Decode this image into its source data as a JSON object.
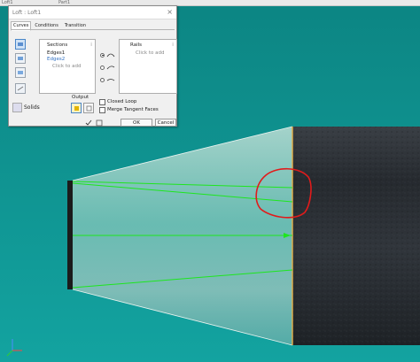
{
  "top": {
    "left_text": "Loft1",
    "mid_text": "Part1"
  },
  "dialog": {
    "title": "Loft : Loft1",
    "close_glyph": "×",
    "tabs": [
      {
        "label": "Curves"
      },
      {
        "label": "Conditions"
      },
      {
        "label": "Transition"
      }
    ],
    "sections": {
      "header": "Sections",
      "items": [
        "Edges1",
        "Edges2"
      ],
      "hint": "Click to add"
    },
    "rails": {
      "header": "Rails",
      "hint": "Click to add"
    },
    "solids_label": "Solids",
    "output_label": "Output",
    "checkboxes": [
      {
        "label": "Closed Loop",
        "checked": false
      },
      {
        "label": "Merge Tangent Faces",
        "checked": false
      }
    ],
    "ok_label": "OK",
    "cancel_label": "Cancel"
  },
  "colors": {
    "background": "#0e8e8c",
    "loft_fill": "#c7e0d6",
    "rail_line": "#1ee61e",
    "annotation": "#e11b1b",
    "cylinder": "#2b3036"
  }
}
